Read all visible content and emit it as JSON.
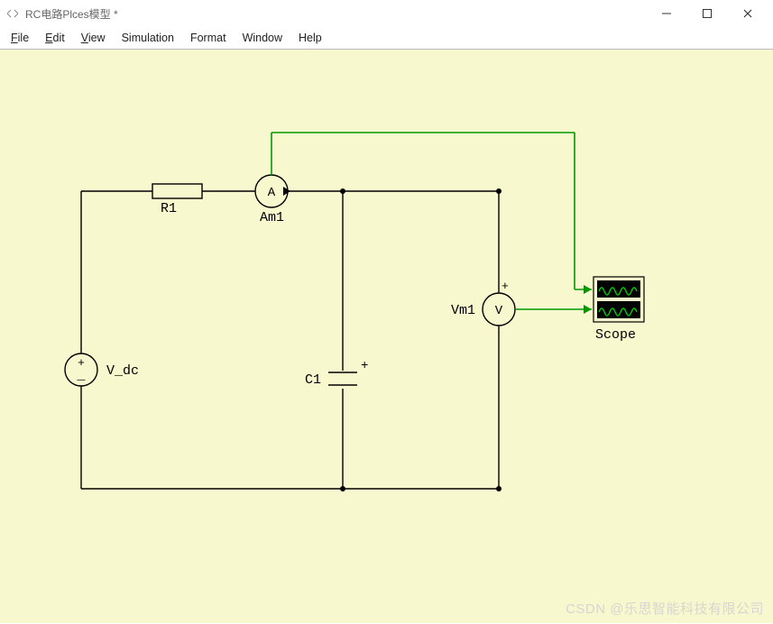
{
  "window": {
    "title": "RC电路Plces模型 *"
  },
  "menu": {
    "file": "File",
    "edit": "Edit",
    "view": "View",
    "simulation": "Simulation",
    "format": "Format",
    "window": "Window",
    "help": "Help"
  },
  "labels": {
    "r1": "R1",
    "am1": "Am1",
    "vdc": "V_dc",
    "c1": "C1",
    "vm1": "Vm1",
    "scope": "Scope",
    "ammeter_letter": "A",
    "voltmeter_letter": "V",
    "plus": "+",
    "minus": "−"
  },
  "watermark": "CSDN @乐思智能科技有限公司",
  "colors": {
    "canvas_bg": "#f8f8cf",
    "wire": "#000000",
    "signal": "#009900",
    "scope_fill": "#000000",
    "scope_wave": "#00cc00"
  }
}
